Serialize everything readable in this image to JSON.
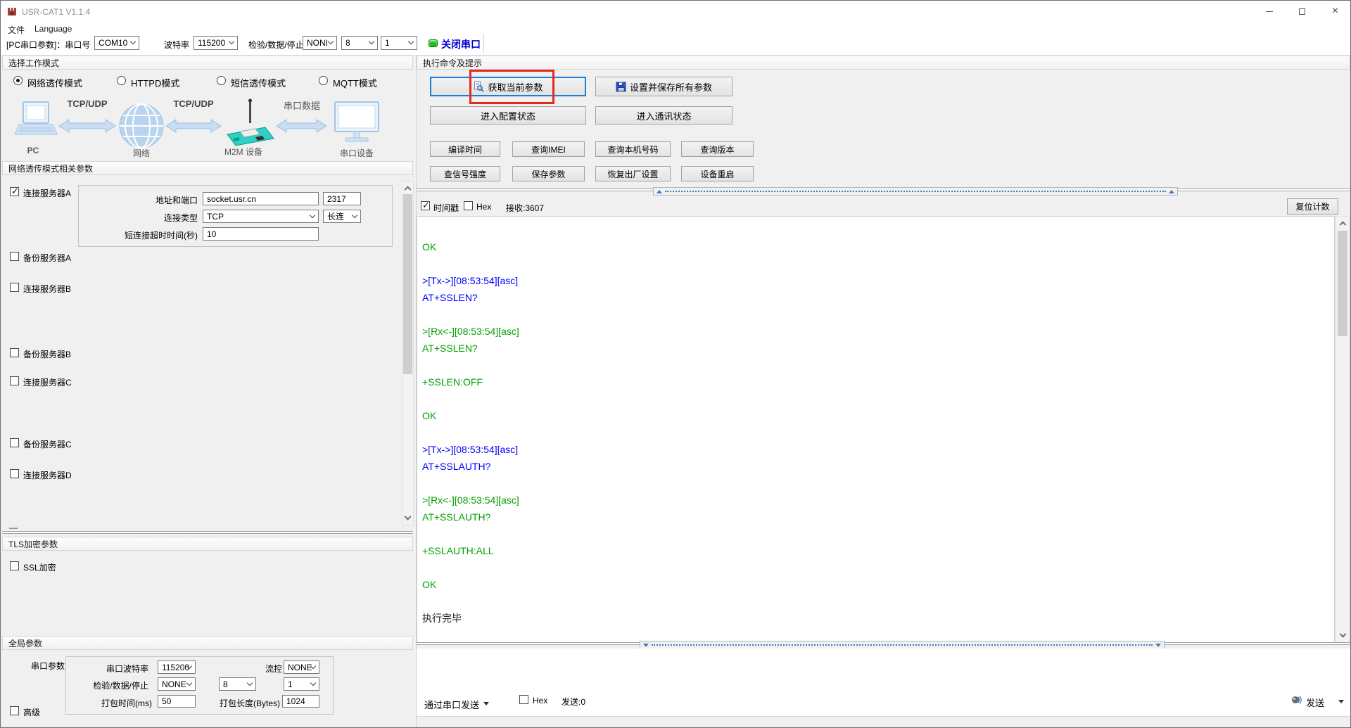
{
  "window": {
    "title": "USR-CAT1 V1.1.4"
  },
  "menu": {
    "file": "文件",
    "language": "Language"
  },
  "toolbar": {
    "label": "[PC串口参数]：串口号",
    "com_port": "COM10",
    "baud_label": "波特率",
    "baud_value": "115200",
    "frame_label": "检验/数据/停止",
    "parity": "NONI",
    "data_bits": "8",
    "stop_bits": "1",
    "close_button": "关闭串口"
  },
  "left": {
    "mode": {
      "header": "选择工作模式",
      "options": [
        {
          "label": "网络透传模式",
          "selected": true
        },
        {
          "label": "HTTPD模式",
          "selected": false
        },
        {
          "label": "短信透传模式",
          "selected": false
        },
        {
          "label": "MQTT模式",
          "selected": false
        }
      ]
    },
    "diagram": {
      "link1": "TCP/UDP",
      "link2": "TCP/UDP",
      "link3": "串口数据",
      "node1": "PC",
      "node2": "网络",
      "node3": "M2M 设备",
      "node4": "串口设备"
    },
    "params": {
      "header": "网络透传模式相关参数",
      "server_a_label": "连接服务器A",
      "addr_label": "地址和端口",
      "addr_value": "socket.usr.cn",
      "port_value": "2317",
      "type_label": "连接类型",
      "type_value": "TCP",
      "keep_value": "长连",
      "timeout_label": "短连接超时时间(秒)",
      "timeout_value": "10",
      "servers": [
        {
          "label": "备份服务器A"
        },
        {
          "label": "连接服务器B"
        },
        {
          "label": "备份服务器B"
        },
        {
          "label": "连接服务器C"
        },
        {
          "label": "备份服务器C"
        },
        {
          "label": "连接服务器D"
        }
      ],
      "overflow_text": "—"
    },
    "tls": {
      "header": "TLS加密参数",
      "ssl_label": "SSL加密"
    },
    "global": {
      "header": "全局参数",
      "group_label": "串口参数",
      "baud_label": "串口波特率",
      "baud_value": "115200",
      "flow_label": "流控",
      "flow_value": "NONE",
      "frame_label": "检验/数据/停止",
      "parity_value": "NONE",
      "data_value": "8",
      "stop_value": "1",
      "pack_time_label": "打包时间(ms)",
      "pack_time_value": "50",
      "pack_len_label": "打包长度(Bytes)",
      "pack_len_value": "1024",
      "advanced_label": "高级"
    }
  },
  "right": {
    "header": "执行命令及提示",
    "get_params": "获取当前参数",
    "set_save": "设置并保存所有参数",
    "enter_config": "进入配置状态",
    "enter_comm": "进入通讯状态",
    "small_buttons": [
      {
        "label": "编译时间"
      },
      {
        "label": "查询IMEI"
      },
      {
        "label": "查询本机号码"
      },
      {
        "label": "查询版本"
      },
      {
        "label": "查信号强度"
      },
      {
        "label": "保存参数"
      },
      {
        "label": "恢复出厂设置"
      },
      {
        "label": "设备重启"
      }
    ],
    "log_bar": {
      "timestamp": "时间戳",
      "hex": "Hex",
      "received": "接收:3607",
      "reset": "复位计数"
    },
    "log": {
      "lines": [
        {
          "text": "OK",
          "color": "green"
        },
        {
          "text": "",
          "color": "none"
        },
        {
          "text": ">[Tx->][08:53:54][asc]",
          "color": "blue"
        },
        {
          "text": "AT+SSLEN?",
          "color": "blue"
        },
        {
          "text": "",
          "color": "none"
        },
        {
          "text": ">[Rx<-][08:53:54][asc]",
          "color": "green"
        },
        {
          "text": "AT+SSLEN?",
          "color": "green"
        },
        {
          "text": "",
          "color": "none"
        },
        {
          "text": "+SSLEN:OFF",
          "color": "green"
        },
        {
          "text": "",
          "color": "none"
        },
        {
          "text": "OK",
          "color": "green"
        },
        {
          "text": "",
          "color": "none"
        },
        {
          "text": ">[Tx->][08:53:54][asc]",
          "color": "blue"
        },
        {
          "text": "AT+SSLAUTH?",
          "color": "blue"
        },
        {
          "text": "",
          "color": "none"
        },
        {
          "text": ">[Rx<-][08:53:54][asc]",
          "color": "green"
        },
        {
          "text": "AT+SSLAUTH?",
          "color": "green"
        },
        {
          "text": "",
          "color": "none"
        },
        {
          "text": "+SSLAUTH:ALL",
          "color": "green"
        },
        {
          "text": "",
          "color": "none"
        },
        {
          "text": "OK",
          "color": "green"
        },
        {
          "text": "",
          "color": "none"
        },
        {
          "text": "执行完毕",
          "color": "black"
        }
      ]
    },
    "send_bar": {
      "via": "通过串口发送",
      "hex": "Hex",
      "sent": "发送:0",
      "send": "发送"
    }
  },
  "colors": {
    "close_button_text": "#0000d6",
    "led_green": "#1cc01c",
    "log_green": "#00a000",
    "log_blue": "#0000ff",
    "focus_border": "#1b7fd4",
    "annotation_red": "#e8271f"
  }
}
